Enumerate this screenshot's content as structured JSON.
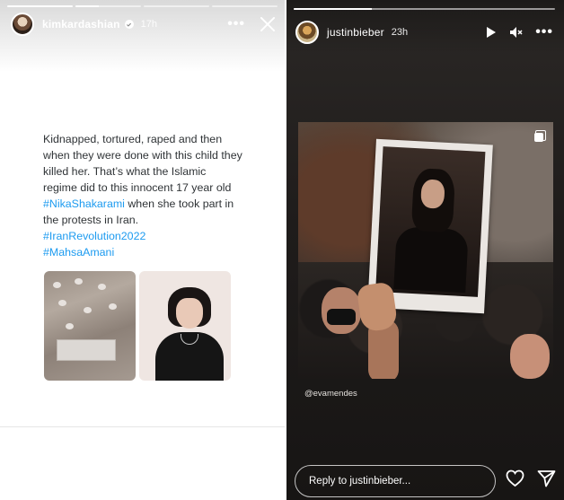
{
  "left_story": {
    "username": "kimkardashian",
    "timestamp": "17h",
    "more_label": "•••",
    "tweet": {
      "body": "Kidnapped, tortured, raped and then when they were done with this child they killed her. That’s what the Islamic regime did to this innocent 17 year old",
      "mention_tag": "#NikaShakarami",
      "body_tail": "when she took part in the protests in Iran.",
      "hashtags": [
        "#IranRevolution2022",
        "#MahsaAmani"
      ]
    },
    "progress": [
      1,
      0.35,
      0,
      0
    ]
  },
  "right_story": {
    "username": "justinbieber",
    "timestamp": "23h",
    "more_label": "•••",
    "progress": [
      0.3
    ],
    "photo_credit": "@evamendes",
    "reply_placeholder": "Reply to justinbieber..."
  },
  "colors": {
    "link_blue": "#1d9bf0",
    "text_dark": "#2f3336",
    "story_dark": "#1f1c1b"
  },
  "icons": [
    "verified-icon",
    "more-icon",
    "close-icon",
    "play-icon",
    "mute-icon",
    "carousel-icon",
    "heart-icon",
    "send-icon"
  ]
}
